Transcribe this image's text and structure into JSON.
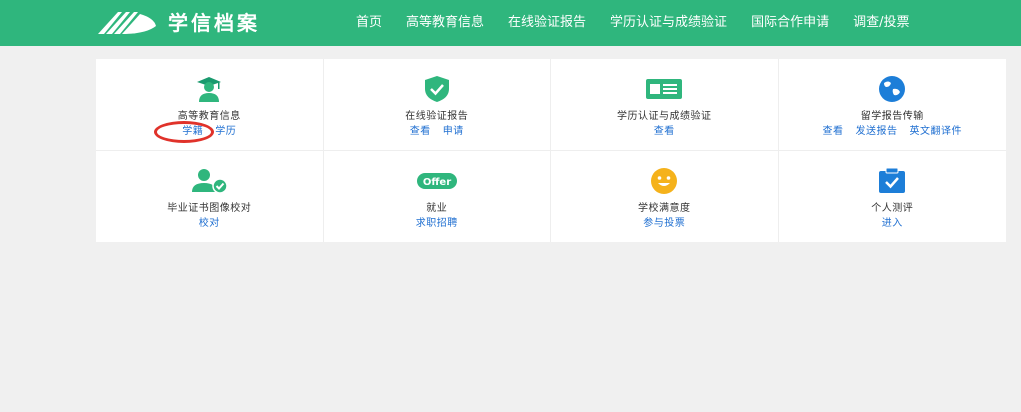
{
  "header": {
    "brand": "学信档案",
    "nav": [
      "首页",
      "高等教育信息",
      "在线验证报告",
      "学历认证与成绩验证",
      "国际合作申请",
      "调查/投票"
    ]
  },
  "cards": [
    {
      "title": "高等教育信息",
      "icon": "graduate-icon",
      "links": [
        "学籍",
        "学历"
      ]
    },
    {
      "title": "在线验证报告",
      "icon": "shield-check-icon",
      "links": [
        "查看",
        "申请"
      ]
    },
    {
      "title": "学历认证与成绩验证",
      "icon": "id-card-icon",
      "links": [
        "查看"
      ]
    },
    {
      "title": "留学报告传输",
      "icon": "globe-icon",
      "links": [
        "查看",
        "发送报告",
        "英文翻译件"
      ]
    },
    {
      "title": "毕业证书图像校对",
      "icon": "user-check-icon",
      "links": [
        "校对"
      ]
    },
    {
      "title": "就业",
      "icon": "offer-icon",
      "icon_text": "Offer",
      "links": [
        "求职招聘"
      ]
    },
    {
      "title": "学校满意度",
      "icon": "smiley-icon",
      "links": [
        "参与投票"
      ]
    },
    {
      "title": "个人测评",
      "icon": "clipboard-check-icon",
      "links": [
        "进入"
      ]
    }
  ],
  "colors": {
    "header": "#2fb67d",
    "link": "#1f6fd1",
    "highlight": "#e0322a"
  }
}
